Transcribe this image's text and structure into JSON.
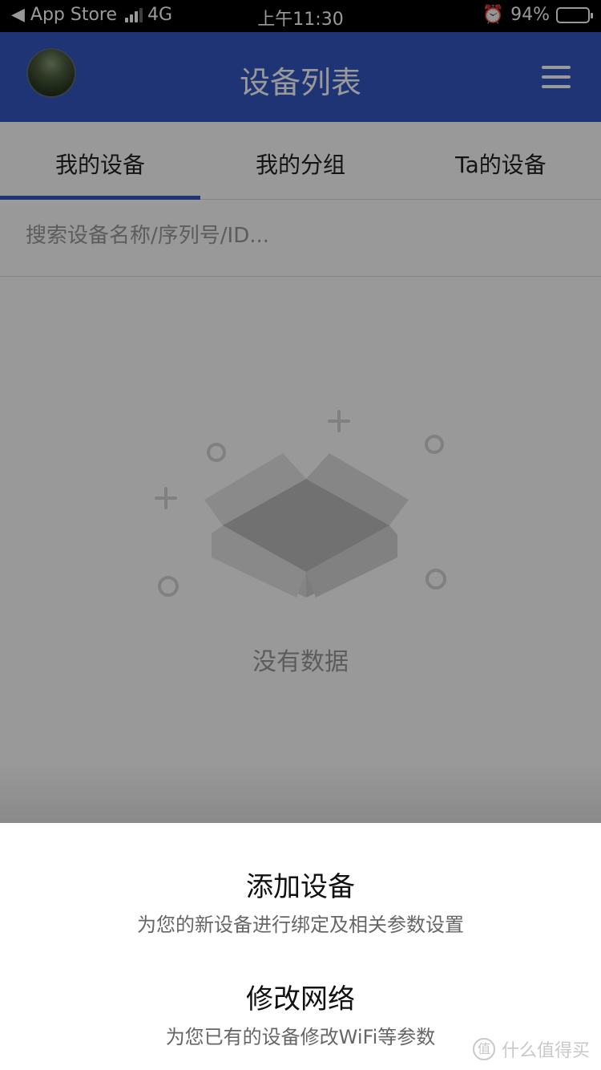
{
  "status_bar": {
    "back_label": "◀ App Store",
    "network": "4G",
    "time": "上午11:30",
    "battery": "94%",
    "battery_level": 0.94
  },
  "header": {
    "title": "设备列表"
  },
  "tabs": [
    {
      "label": "我的设备",
      "active": true
    },
    {
      "label": "我的分组",
      "active": false
    },
    {
      "label": "Ta的设备",
      "active": false
    }
  ],
  "search": {
    "placeholder": "搜索设备名称/序列号/ID..."
  },
  "empty": {
    "text": "没有数据"
  },
  "sheet": {
    "items": [
      {
        "title": "添加设备",
        "desc": "为您的新设备进行绑定及相关参数设置"
      },
      {
        "title": "修改网络",
        "desc": "为您已有的设备修改WiFi等参数"
      }
    ]
  },
  "watermark": {
    "mark": "值",
    "text": "什么值得买"
  },
  "colors": {
    "header_bg": "#3357c4",
    "overlay": "rgba(0,0,0,0.40)"
  }
}
